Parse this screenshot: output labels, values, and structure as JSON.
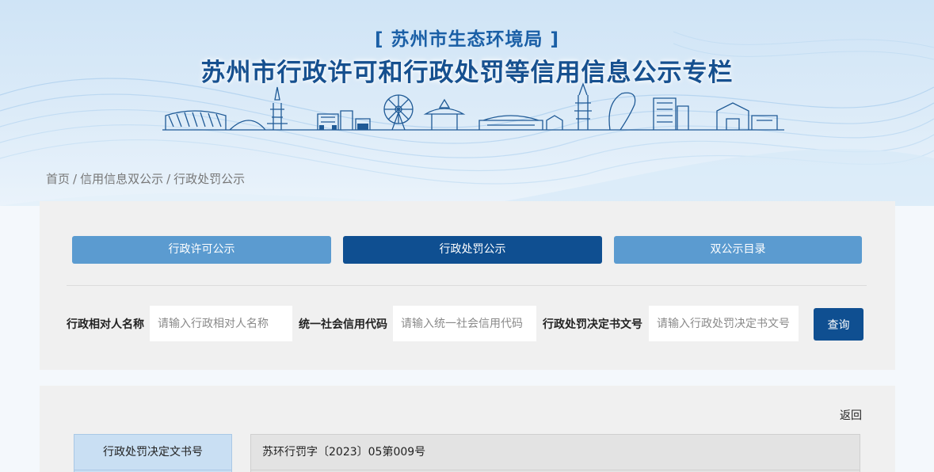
{
  "header": {
    "subtitle": "[ 苏州市生态环境局 ]",
    "title": "苏州市行政许可和行政处罚等信用信息公示专栏"
  },
  "breadcrumb": {
    "items": [
      "首页",
      "信用信息双公示",
      "行政处罚公示"
    ],
    "separator": "/"
  },
  "tabs": [
    {
      "label": "行政许可公示",
      "active": false
    },
    {
      "label": "行政处罚公示",
      "active": true
    },
    {
      "label": "双公示目录",
      "active": false
    }
  ],
  "search": {
    "fields": [
      {
        "label": "行政相对人名称",
        "placeholder": "请输入行政相对人名称",
        "value": ""
      },
      {
        "label": "统一社会信用代码",
        "placeholder": "请输入统一社会信用代码",
        "value": ""
      },
      {
        "label": "行政处罚决定书文号",
        "placeholder": "请输入行政处罚决定书文号",
        "value": ""
      }
    ],
    "submit_label": "查询"
  },
  "detail": {
    "back_label": "返回",
    "rows": [
      {
        "label": "行政处罚决定文书号",
        "value": "苏环行罚字〔2023〕05第009号"
      }
    ]
  },
  "colors": {
    "primary": "#0f4f91",
    "tab_light": "#5b9bd0",
    "title": "#16508f",
    "panel_bg": "#f0f0f0"
  }
}
